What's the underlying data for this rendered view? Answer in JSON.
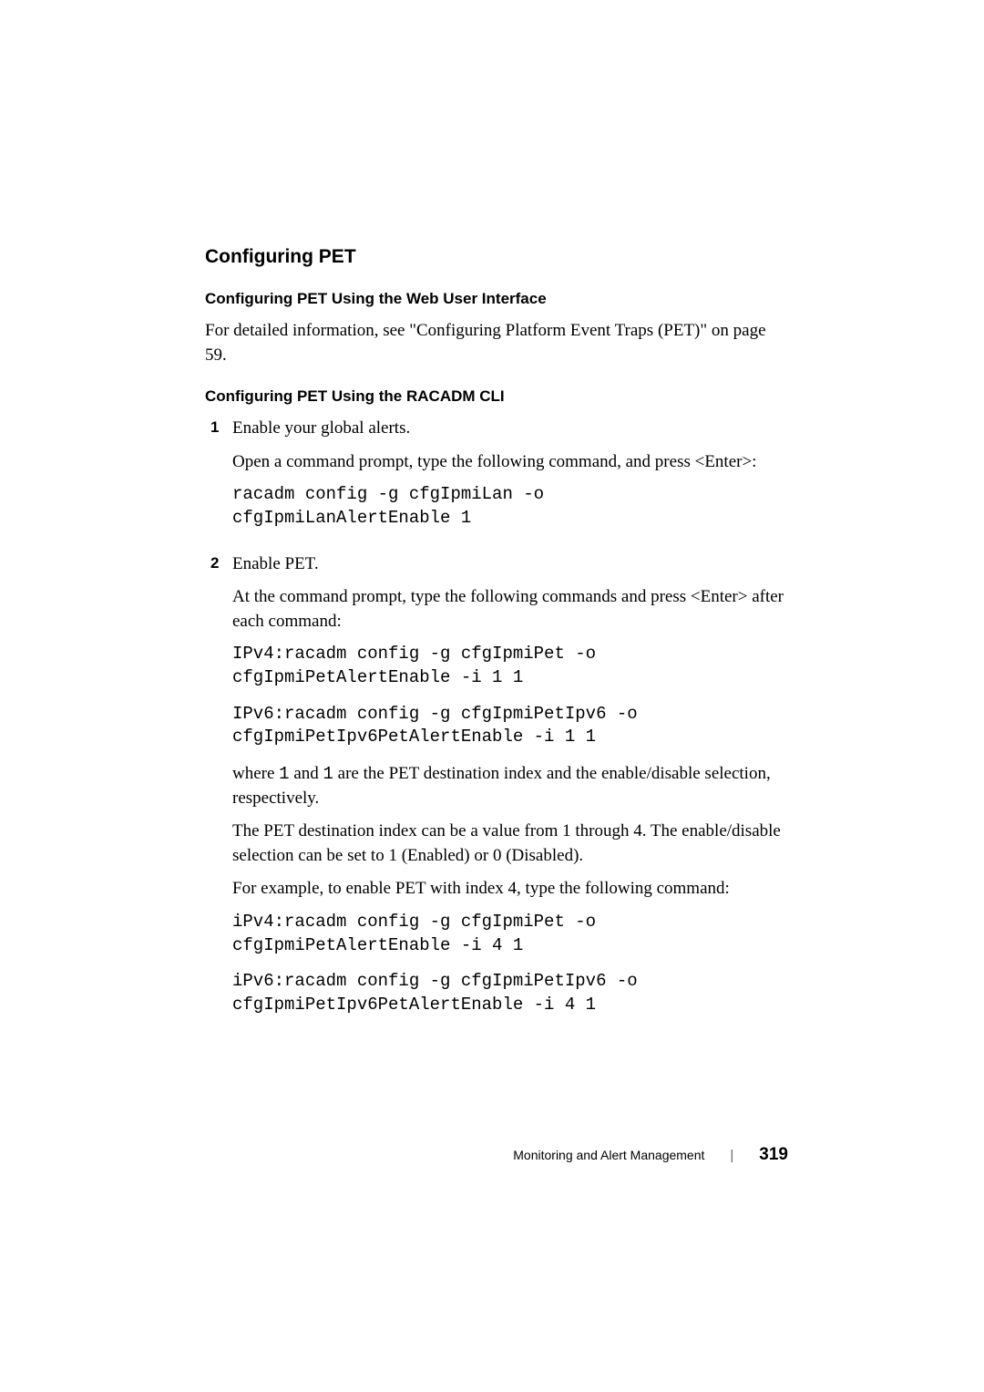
{
  "headings": {
    "section": "Configuring PET",
    "sub_web": "Configuring PET Using the Web User Interface",
    "sub_cli": "Configuring PET Using the RACADM CLI"
  },
  "web": {
    "para": "For detailed information, see \"Configuring Platform Event Traps (PET)\" on page 59."
  },
  "steps": {
    "one_marker": "1",
    "one_intro": "Enable your global alerts.",
    "one_para": "Open a command prompt, type the following command, and press <Enter>:",
    "one_code": "racadm config -g cfgIpmiLan -o\ncfgIpmiLanAlertEnable 1",
    "two_marker": "2",
    "two_intro": "Enable PET.",
    "two_para": "At the command prompt, type the following commands and press <Enter> after each command:",
    "two_code_ipv4": "IPv4:racadm config -g cfgIpmiPet -o\ncfgIpmiPetAlertEnable -i 1 1",
    "two_code_ipv6": "IPv6:racadm config -g cfgIpmiPetIpv6 -o\ncfgIpmiPetIpv6PetAlertEnable -i 1 1",
    "two_where_pre": "where ",
    "two_where_one1": "1",
    "two_where_mid": " and ",
    "two_where_one2": "1",
    "two_where_post": " are the PET destination index and the enable/disable selection, respectively.",
    "two_ranges": "The PET destination index can be a value from 1 through 4. The enable/disable selection can be set to 1 (Enabled) or 0 (Disabled).",
    "two_example_intro": "For example, to enable PET with index 4, type the following command:",
    "two_code_ipv4_ex": "iPv4:racadm config -g cfgIpmiPet -o\ncfgIpmiPetAlertEnable -i 4 1",
    "two_code_ipv6_ex": "iPv6:racadm config -g cfgIpmiPetIpv6 -o\ncfgIpmiPetIpv6PetAlertEnable -i 4 1"
  },
  "footer": {
    "chapter": "Monitoring and Alert Management",
    "sep": "|",
    "page": "319"
  }
}
